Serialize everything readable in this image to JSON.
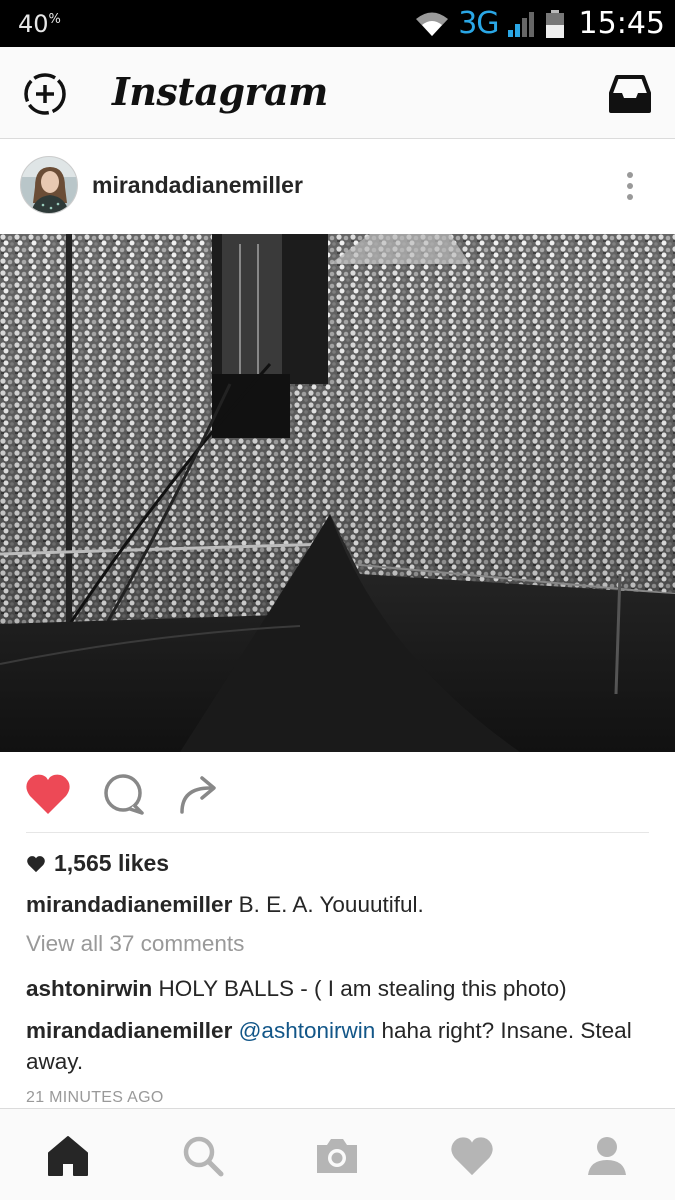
{
  "status_bar": {
    "battery": "40",
    "battery_symbol": "%",
    "network": "3G",
    "time": "15:45"
  },
  "header": {
    "brand": "Instagram",
    "icons": [
      "new-story-icon",
      "inbox-icon"
    ]
  },
  "post": {
    "username": "mirandadianemiller",
    "image_description_icon": "concert-crowd-photo",
    "liked": true,
    "likes": "1,565 likes",
    "caption": {
      "user": "mirandadianemiller",
      "text": "B. E. A. Youuutiful."
    },
    "view_all": "View all 37 comments",
    "comments": [
      {
        "user": "ashtonirwin",
        "mention": "",
        "text": "HOLY BALLS - ( I am stealing this photo)"
      },
      {
        "user": "mirandadianemiller",
        "mention": "@ashtonirwin",
        "text": "haha right? Insane. Steal away."
      }
    ],
    "time": "21 MINUTES AGO"
  },
  "colors": {
    "like": "#ed4956",
    "network": "#2aa7e6",
    "mention": "#125688"
  },
  "bottom_nav": [
    "home-icon",
    "search-icon",
    "camera-icon",
    "heart-icon",
    "profile-icon"
  ]
}
